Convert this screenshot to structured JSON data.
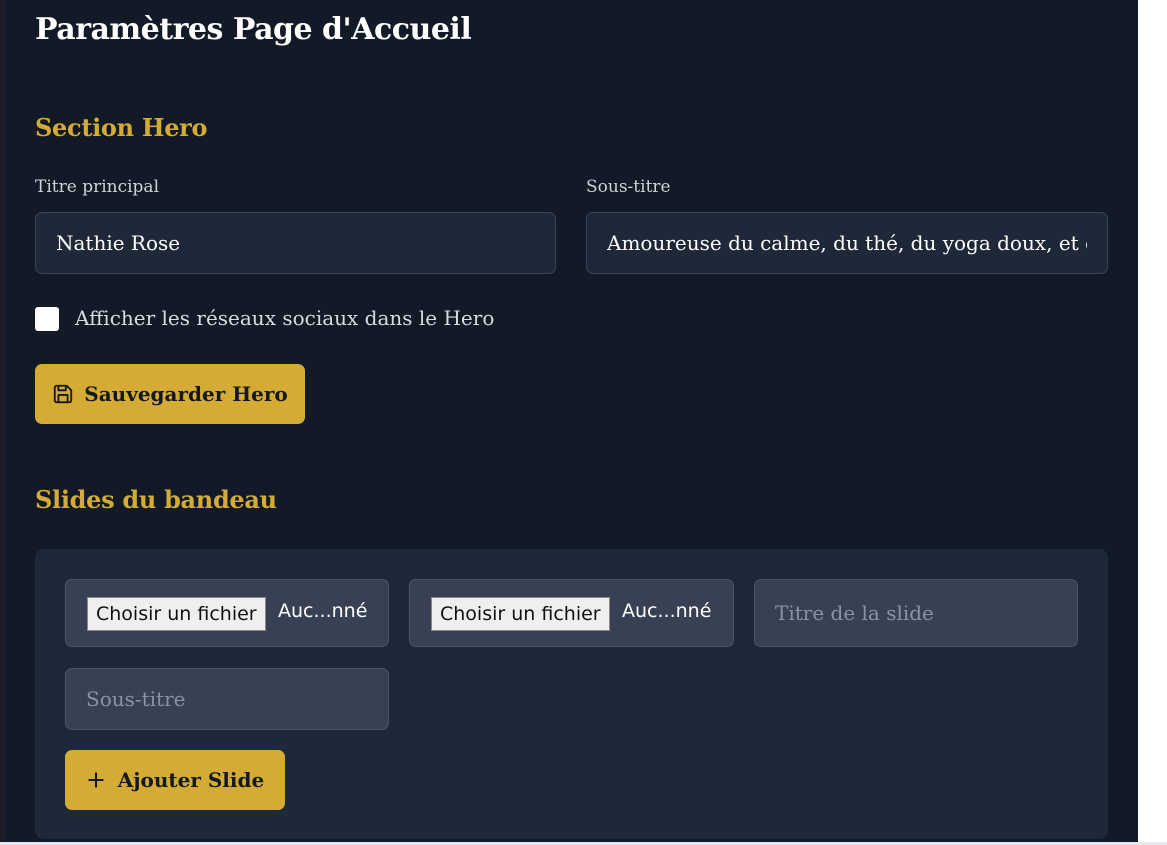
{
  "page": {
    "title": "Paramètres Page d'Accueil"
  },
  "hero": {
    "section_title": "Section Hero",
    "titre_label": "Titre principal",
    "titre_value": "Nathie Rose",
    "soustitre_label": "Sous-titre",
    "soustitre_value": "Amoureuse du calme, du thé, du yoga doux, et des",
    "checkbox_label": "Afficher les réseaux sociaux dans le Hero",
    "checkbox_checked": false,
    "save_label": "Sauvegarder Hero",
    "save_icon": "save-icon"
  },
  "slides": {
    "section_title": "Slides du bandeau",
    "file_button_label": "Choisir un fichier",
    "file_status": "Auc...nné",
    "titre_placeholder": "Titre de la slide",
    "soustitre_placeholder": "Sous-titre",
    "add_label": "Ajouter Slide",
    "add_icon": "plus-icon"
  },
  "colors": {
    "background": "#121927",
    "accent": "#d4ab34",
    "card": "#1f2838"
  }
}
